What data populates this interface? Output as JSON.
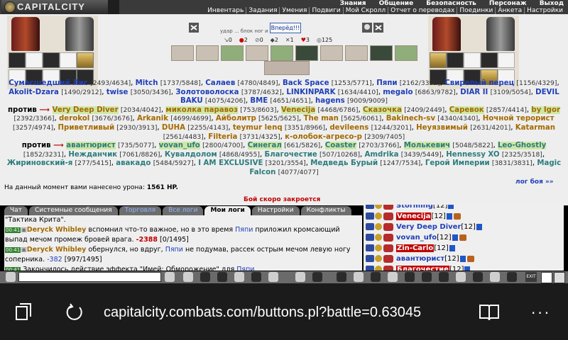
{
  "header": {
    "logo_text": "CAPITALCITY",
    "nav_top": [
      "Знания",
      "Общение",
      "Безопасность",
      "Персонаж",
      "Выход"
    ],
    "nav_bottom": [
      "Инвентарь",
      "Задания",
      "Умения",
      "Подвиги",
      "Мой Скролл",
      "Отчет о переводах",
      "Поединки",
      "Анкета",
      "Настройки"
    ]
  },
  "battle": {
    "strike_text": "удар ... блок ног и головы",
    "vpered_label": "Вперёд!!!",
    "counters": [
      "0",
      "2",
      "0",
      "2",
      "1",
      "3",
      "125"
    ],
    "team_vs_label": "против",
    "team1": [
      {
        "name": "Сумасшедший Лис",
        "hp": "[2493/4634]",
        "c": "b"
      },
      {
        "name": "Mitch",
        "hp": "[1737/5848]",
        "c": "b"
      },
      {
        "name": "Салаев",
        "hp": "[4780/4849]",
        "c": "b"
      },
      {
        "name": "Back Space",
        "hp": "[1253/5771]",
        "c": "b"
      },
      {
        "name": "Пяпи",
        "hp": "[2162/3392]",
        "c": "b"
      },
      {
        "name": "Свирепый перец",
        "hp": "[1156/4329]",
        "c": "b"
      },
      {
        "name": "Akolit-Dzara",
        "hp": "[1490/2912]",
        "c": "b"
      },
      {
        "name": "twise",
        "hp": "[3050/3436]",
        "c": "b"
      },
      {
        "name": "Золотоволоска",
        "hp": "[3787/4632]",
        "c": "b"
      },
      {
        "name": "LINKINPARK",
        "hp": "[1634/4410]",
        "c": "b"
      },
      {
        "name": "megalo",
        "hp": "[6863/9782]",
        "c": "b"
      },
      {
        "name": "DIAR II",
        "hp": "[3109/5054]",
        "c": "b"
      },
      {
        "name": "DEVIL BAKU",
        "hp": "[4075/4206]",
        "c": "b"
      },
      {
        "name": "BME",
        "hp": "[4651/4651]",
        "c": "b"
      },
      {
        "name": "hagens",
        "hp": "[9009/9009]",
        "c": "b"
      }
    ],
    "team2": [
      {
        "name": "Very Deep Diver",
        "hp": "[2034/4042]",
        "c": "o",
        "hl": true
      },
      {
        "name": "миколка паравоз",
        "hp": "[753/8603]",
        "c": "o",
        "hl": true
      },
      {
        "name": "Venecija",
        "hp": "[4468/6786]",
        "c": "o",
        "hl": true
      },
      {
        "name": "Сказочка",
        "hp": "[2409/2449]",
        "c": "o",
        "hl": true
      },
      {
        "name": "Саревок",
        "hp": "[2857/4414]",
        "c": "o",
        "hl": true
      },
      {
        "name": "by Igor",
        "hp": "[2392/3366]",
        "c": "o",
        "hl": true
      },
      {
        "name": "derokol",
        "hp": "[3676/3676]",
        "c": "o"
      },
      {
        "name": "Arkanik",
        "hp": "[4699/4699]",
        "c": "o"
      },
      {
        "name": "Айболитр",
        "hp": "[5625/5625]",
        "c": "o"
      },
      {
        "name": "The man",
        "hp": "[5625/6061]",
        "c": "o"
      },
      {
        "name": "Bakinech-sv",
        "hp": "[4340/4340]",
        "c": "o"
      },
      {
        "name": "Ночной терорист",
        "hp": "[3257/4974]",
        "c": "o"
      },
      {
        "name": "Приветливый",
        "hp": "[2930/3913]",
        "c": "o"
      },
      {
        "name": "DUHA",
        "hp": "[2255/4143]",
        "c": "o"
      },
      {
        "name": "teymur lenq",
        "hp": "[3351/8966]",
        "c": "o"
      },
      {
        "name": "devileens",
        "hp": "[1244/3201]",
        "c": "o"
      },
      {
        "name": "Неуязвимый",
        "hp": "[2631/4201]",
        "c": "o"
      },
      {
        "name": "Katarman",
        "hp": "[2561/4483]",
        "c": "o"
      },
      {
        "name": "Filteria",
        "hp": "[3731/4325]",
        "c": "o"
      },
      {
        "name": "к-олобок-агресо-р",
        "hp": "[2309/7405]",
        "c": "o"
      }
    ],
    "team3": [
      {
        "name": "авантюрист",
        "hp": "[735/5077]",
        "c": "t",
        "hl": true
      },
      {
        "name": "vovan_ufo",
        "hp": "[2800/4700]",
        "c": "t",
        "hl": true
      },
      {
        "name": "Синегал",
        "hp": "[661/5826]",
        "c": "t",
        "hl": true
      },
      {
        "name": "Coaster",
        "hp": "[2703/3766]",
        "c": "t",
        "hl": true
      },
      {
        "name": "Молькевич",
        "hp": "[5048/5822]",
        "c": "t",
        "hl": true
      },
      {
        "name": "Leo-Ghostly",
        "hp": "[1852/3231]",
        "c": "t",
        "hl": true
      },
      {
        "name": "Нежданчик",
        "hp": "[7061/8826]",
        "c": "t"
      },
      {
        "name": "Кувалдолом",
        "hp": "[4868/4955]",
        "c": "t"
      },
      {
        "name": "Благочестие",
        "hp": "[507/10268]",
        "c": "t"
      },
      {
        "name": "Amdrika",
        "hp": "[3439/5449]",
        "c": "t"
      },
      {
        "name": "Hennessy XO",
        "hp": "[2325/3518]",
        "c": "t"
      },
      {
        "name": "Жириновский-я",
        "hp": "[277/5415]",
        "c": "t"
      },
      {
        "name": "авакадо",
        "hp": "[5484/5927]",
        "c": "t"
      },
      {
        "name": "I AM EXCLUSIVE",
        "hp": "[3201/3554]",
        "c": "t"
      },
      {
        "name": "Медведь Бурый",
        "hp": "[1247/7534]",
        "c": "t"
      },
      {
        "name": "Герой Империи",
        "hp": "[3831/3831]",
        "c": "t"
      },
      {
        "name": "Magic Falcon",
        "hp": "[4077/4077]",
        "c": "t"
      }
    ],
    "damage_text": "На данный момент вами нанесено урона:",
    "damage_value": "1561 HP.",
    "log_link": "лог боя »»",
    "closing_text": "Бой скоро закроется"
  },
  "chat": {
    "tabs": [
      {
        "label": "Чат"
      },
      {
        "label": "Системные сообщения"
      },
      {
        "label": "Торговля"
      },
      {
        "label": "Все логи"
      },
      {
        "label": "Мои логи"
      },
      {
        "label": "Настройки"
      },
      {
        "label": "Конфликты"
      }
    ],
    "messages": [
      {
        "ts": "",
        "parts": [
          [
            "",
            "\"Тактика Крита\"."
          ]
        ]
      },
      {
        "ts": "00:41",
        "parts": [
          [
            "chat-name",
            "Deryck Whibley"
          ],
          [
            "",
            " вспомнил что-то важное, но в это время "
          ],
          [
            "chat-blue",
            "Пяпи"
          ],
          [
            "",
            " приложил кромсающий выпад мечом промеж бровей врага. "
          ],
          [
            "chat-red",
            "-2388"
          ],
          [
            "",
            " [0/1495]"
          ]
        ]
      },
      {
        "ts": "00:41",
        "parts": [
          [
            "chat-name",
            "Deryck Whibley"
          ],
          [
            "",
            " обернулся, но вдруг, "
          ],
          [
            "chat-blue",
            "Пяпи"
          ],
          [
            "",
            " не подумав, рассек острым мечом левую ногу соперника. "
          ],
          [
            "chat-num",
            "-382"
          ],
          [
            "",
            " [997/1495]"
          ]
        ]
      },
      {
        "ts": "00:41",
        "parts": [
          [
            "",
            " Закончилось действие эффекта \"Имей: Обморожение\" для "
          ],
          [
            "chat-blue",
            "Пяпи"
          ]
        ]
      }
    ]
  },
  "players": [
    {
      "name": "Storming",
      "lvl": "[12]",
      "red": false
    },
    {
      "name": "Venecija",
      "lvl": "[12]",
      "red": true
    },
    {
      "name": "Very Deep Diver",
      "lvl": "[12]",
      "red": false
    },
    {
      "name": "vovan_ufo",
      "lvl": "[12]",
      "red": false
    },
    {
      "name": "Zin-Carlo",
      "lvl": "[12]",
      "red": true
    },
    {
      "name": "авантюрист",
      "lvl": "[12]",
      "red": false
    },
    {
      "name": "Благочестие",
      "lvl": "[12]",
      "red": true
    }
  ],
  "toolbar": {
    "exit_label": "EXIT"
  },
  "browser": {
    "url": "capitalcity.combats.com/buttons.pl?battle=0.63045"
  }
}
